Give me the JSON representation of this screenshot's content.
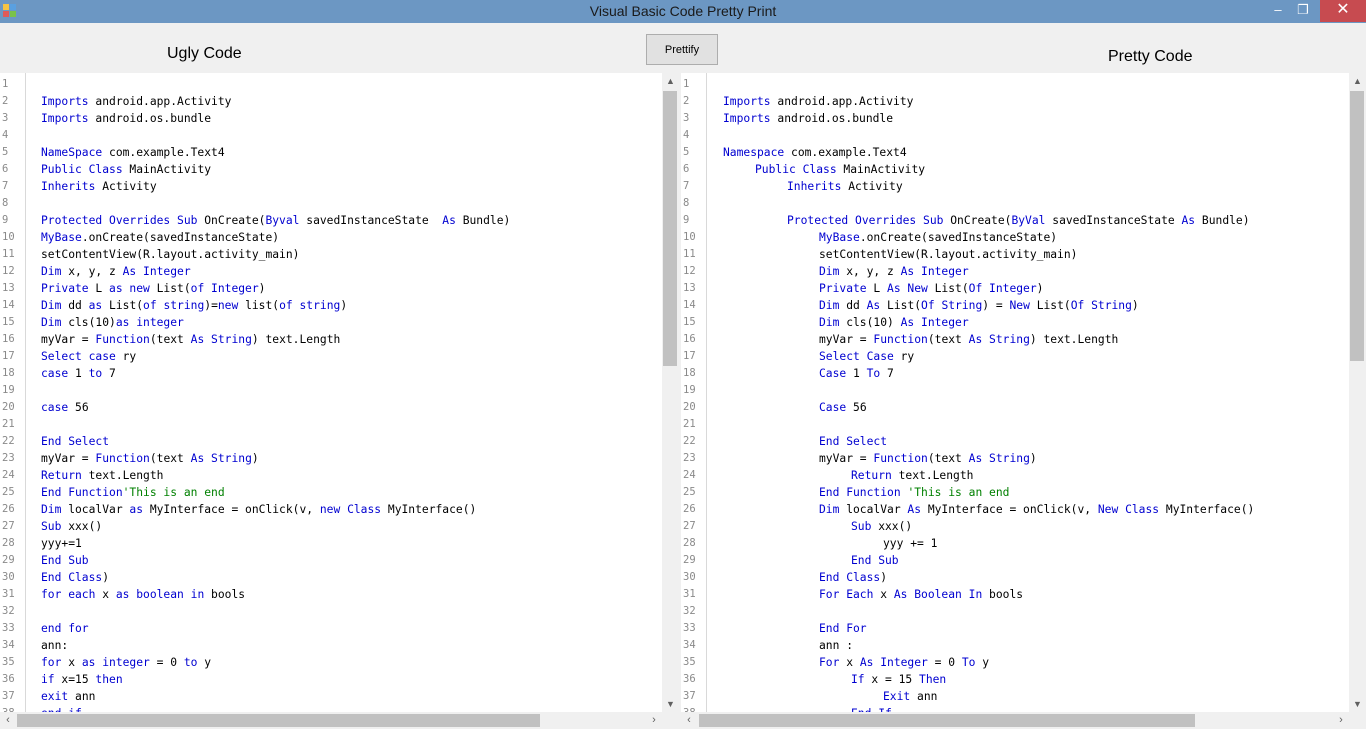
{
  "window": {
    "title": "Visual Basic Code Pretty Print",
    "controls": {
      "minimize": "–",
      "maximize": "❐",
      "close": "✕"
    },
    "titlebar_color": "#6c97c3",
    "close_color": "#c74b50",
    "icon": "vb-app-icon"
  },
  "labels": {
    "ugly": "Ugly Code",
    "pretty": "Pretty Code"
  },
  "prettify_button": "Prettify",
  "colors": {
    "keyword": "#0000d0",
    "comment": "#008000",
    "text": "#000000",
    "line_number": "#8a8a8a"
  },
  "scroll_arrows": {
    "up": "▲",
    "down": "▼",
    "left": "‹",
    "right": "›"
  },
  "ugly_code": [
    [],
    [
      [
        "Imports",
        "k"
      ],
      [
        " android.app.Activity",
        "t"
      ]
    ],
    [
      [
        "Imports",
        "k"
      ],
      [
        " android.os.bundle",
        "t"
      ]
    ],
    [],
    [
      [
        "NameSpace",
        "k"
      ],
      [
        " com.example.Text4",
        "t"
      ]
    ],
    [
      [
        "Public Class",
        "k"
      ],
      [
        " MainActivity",
        "t"
      ]
    ],
    [
      [
        "Inherits",
        "k"
      ],
      [
        " Activity",
        "t"
      ]
    ],
    [],
    [
      [
        "Protected Overrides Sub",
        "k"
      ],
      [
        " OnCreate(",
        "t"
      ],
      [
        "Byval",
        "k"
      ],
      [
        " savedInstanceState  ",
        "t"
      ],
      [
        "As",
        "k"
      ],
      [
        " Bundle)",
        "t"
      ]
    ],
    [
      [
        "MyBase",
        "k"
      ],
      [
        ".onCreate(savedInstanceState)",
        "t"
      ]
    ],
    [
      [
        "setContentView(R.layout.activity_main)",
        "t"
      ]
    ],
    [
      [
        "Dim",
        "k"
      ],
      [
        " x, y, z ",
        "t"
      ],
      [
        "As Integer",
        "k"
      ]
    ],
    [
      [
        "Private",
        "k"
      ],
      [
        " L ",
        "t"
      ],
      [
        "as new",
        "k"
      ],
      [
        " List(",
        "t"
      ],
      [
        "of Integer",
        "k"
      ],
      [
        ")",
        "t"
      ]
    ],
    [
      [
        "Dim",
        "k"
      ],
      [
        " dd ",
        "t"
      ],
      [
        "as",
        "k"
      ],
      [
        " List(",
        "t"
      ],
      [
        "of string",
        "k"
      ],
      [
        ")=",
        "t"
      ],
      [
        "new",
        "k"
      ],
      [
        " list(",
        "t"
      ],
      [
        "of string",
        "k"
      ],
      [
        ")",
        "t"
      ]
    ],
    [
      [
        "Dim",
        "k"
      ],
      [
        " cls(10)",
        "t"
      ],
      [
        "as integer",
        "k"
      ]
    ],
    [
      [
        "myVar = ",
        "t"
      ],
      [
        "Function",
        "k"
      ],
      [
        "(text ",
        "t"
      ],
      [
        "As String",
        "k"
      ],
      [
        ") text.Length",
        "t"
      ]
    ],
    [
      [
        "Select case",
        "k"
      ],
      [
        " ry",
        "t"
      ]
    ],
    [
      [
        "case",
        "k"
      ],
      [
        " 1 ",
        "t"
      ],
      [
        "to",
        "k"
      ],
      [
        " 7",
        "t"
      ]
    ],
    [],
    [
      [
        "case",
        "k"
      ],
      [
        " 56",
        "t"
      ]
    ],
    [],
    [
      [
        "End Select",
        "k"
      ]
    ],
    [
      [
        "myVar = ",
        "t"
      ],
      [
        "Function",
        "k"
      ],
      [
        "(text ",
        "t"
      ],
      [
        "As String",
        "k"
      ],
      [
        ")",
        "t"
      ]
    ],
    [
      [
        "Return",
        "k"
      ],
      [
        " text.Length",
        "t"
      ]
    ],
    [
      [
        "End Function",
        "k"
      ],
      [
        "'This is an end",
        "c"
      ]
    ],
    [
      [
        "Dim",
        "k"
      ],
      [
        " localVar ",
        "t"
      ],
      [
        "as",
        "k"
      ],
      [
        " MyInterface = onClick(v, ",
        "t"
      ],
      [
        "new Class",
        "k"
      ],
      [
        " MyInterface()",
        "t"
      ]
    ],
    [
      [
        "Sub",
        "k"
      ],
      [
        " xxx()",
        "t"
      ]
    ],
    [
      [
        "yyy+=1",
        "t"
      ]
    ],
    [
      [
        "End Sub",
        "k"
      ]
    ],
    [
      [
        "End Class",
        "k"
      ],
      [
        ")",
        "t"
      ]
    ],
    [
      [
        "for each",
        "k"
      ],
      [
        " x ",
        "t"
      ],
      [
        "as boolean in",
        "k"
      ],
      [
        " bools",
        "t"
      ]
    ],
    [],
    [
      [
        "end for",
        "k"
      ]
    ],
    [
      [
        "ann:",
        "t"
      ]
    ],
    [
      [
        "for",
        "k"
      ],
      [
        " x ",
        "t"
      ],
      [
        "as integer",
        "k"
      ],
      [
        " = 0 ",
        "t"
      ],
      [
        "to",
        "k"
      ],
      [
        " y",
        "t"
      ]
    ],
    [
      [
        "if",
        "k"
      ],
      [
        " x=15 ",
        "t"
      ],
      [
        "then",
        "k"
      ]
    ],
    [
      [
        "exit",
        "k"
      ],
      [
        " ann",
        "t"
      ]
    ],
    [
      [
        "end if",
        "k"
      ]
    ]
  ],
  "pretty_code": [
    [
      0
    ],
    [
      0,
      [
        "Imports",
        "k"
      ],
      [
        " android.app.Activity",
        "t"
      ]
    ],
    [
      0,
      [
        "Imports",
        "k"
      ],
      [
        " android.os.bundle",
        "t"
      ]
    ],
    [
      0
    ],
    [
      0,
      [
        "Namespace",
        "k"
      ],
      [
        " com.example.Text4",
        "t"
      ]
    ],
    [
      1,
      [
        "Public Class",
        "k"
      ],
      [
        " MainActivity",
        "t"
      ]
    ],
    [
      2,
      [
        "Inherits",
        "k"
      ],
      [
        " Activity",
        "t"
      ]
    ],
    [
      0
    ],
    [
      2,
      [
        "Protected Overrides Sub",
        "k"
      ],
      [
        " OnCreate(",
        "t"
      ],
      [
        "ByVal",
        "k"
      ],
      [
        " savedInstanceState ",
        "t"
      ],
      [
        "As",
        "k"
      ],
      [
        " Bundle)",
        "t"
      ]
    ],
    [
      3,
      [
        "MyBase",
        "k"
      ],
      [
        ".onCreate(savedInstanceState)",
        "t"
      ]
    ],
    [
      3,
      [
        "setContentView(R.layout.activity_main)",
        "t"
      ]
    ],
    [
      3,
      [
        "Dim",
        "k"
      ],
      [
        " x, y, z ",
        "t"
      ],
      [
        "As Integer",
        "k"
      ]
    ],
    [
      3,
      [
        "Private",
        "k"
      ],
      [
        " L ",
        "t"
      ],
      [
        "As New",
        "k"
      ],
      [
        " List(",
        "t"
      ],
      [
        "Of Integer",
        "k"
      ],
      [
        ")",
        "t"
      ]
    ],
    [
      3,
      [
        "Dim",
        "k"
      ],
      [
        " dd ",
        "t"
      ],
      [
        "As",
        "k"
      ],
      [
        " List(",
        "t"
      ],
      [
        "Of String",
        "k"
      ],
      [
        ") = ",
        "t"
      ],
      [
        "New",
        "k"
      ],
      [
        " List(",
        "t"
      ],
      [
        "Of String",
        "k"
      ],
      [
        ")",
        "t"
      ]
    ],
    [
      3,
      [
        "Dim",
        "k"
      ],
      [
        " cls(10) ",
        "t"
      ],
      [
        "As Integer",
        "k"
      ]
    ],
    [
      3,
      [
        "myVar = ",
        "t"
      ],
      [
        "Function",
        "k"
      ],
      [
        "(text ",
        "t"
      ],
      [
        "As String",
        "k"
      ],
      [
        ") text.Length",
        "t"
      ]
    ],
    [
      3,
      [
        "Select Case",
        "k"
      ],
      [
        " ry",
        "t"
      ]
    ],
    [
      3,
      [
        "Case",
        "k"
      ],
      [
        " 1 ",
        "t"
      ],
      [
        "To",
        "k"
      ],
      [
        " 7",
        "t"
      ]
    ],
    [
      0
    ],
    [
      3,
      [
        "Case",
        "k"
      ],
      [
        " 56",
        "t"
      ]
    ],
    [
      0
    ],
    [
      3,
      [
        "End Select",
        "k"
      ]
    ],
    [
      3,
      [
        "myVar = ",
        "t"
      ],
      [
        "Function",
        "k"
      ],
      [
        "(text ",
        "t"
      ],
      [
        "As String",
        "k"
      ],
      [
        ")",
        "t"
      ]
    ],
    [
      4,
      [
        "Return",
        "k"
      ],
      [
        " text.Length",
        "t"
      ]
    ],
    [
      3,
      [
        "End Function",
        "k"
      ],
      [
        " ",
        "t"
      ],
      [
        "'This is an end",
        "c"
      ]
    ],
    [
      3,
      [
        "Dim",
        "k"
      ],
      [
        " localVar ",
        "t"
      ],
      [
        "As",
        "k"
      ],
      [
        " MyInterface = onClick(v, ",
        "t"
      ],
      [
        "New Class",
        "k"
      ],
      [
        " MyInterface()",
        "t"
      ]
    ],
    [
      4,
      [
        "Sub",
        "k"
      ],
      [
        " xxx()",
        "t"
      ]
    ],
    [
      5,
      [
        "yyy += 1",
        "t"
      ]
    ],
    [
      4,
      [
        "End Sub",
        "k"
      ]
    ],
    [
      3,
      [
        "End Class",
        "k"
      ],
      [
        ")",
        "t"
      ]
    ],
    [
      3,
      [
        "For Each",
        "k"
      ],
      [
        " x ",
        "t"
      ],
      [
        "As Boolean In",
        "k"
      ],
      [
        " bools",
        "t"
      ]
    ],
    [
      0
    ],
    [
      3,
      [
        "End For",
        "k"
      ]
    ],
    [
      3,
      [
        "ann :",
        "t"
      ]
    ],
    [
      3,
      [
        "For",
        "k"
      ],
      [
        " x ",
        "t"
      ],
      [
        "As Integer",
        "k"
      ],
      [
        " = 0 ",
        "t"
      ],
      [
        "To",
        "k"
      ],
      [
        " y",
        "t"
      ]
    ],
    [
      4,
      [
        "If",
        "k"
      ],
      [
        " x = 15 ",
        "t"
      ],
      [
        "Then",
        "k"
      ]
    ],
    [
      5,
      [
        "Exit",
        "k"
      ],
      [
        " ann",
        "t"
      ]
    ],
    [
      4,
      [
        "End If",
        "k"
      ]
    ]
  ]
}
